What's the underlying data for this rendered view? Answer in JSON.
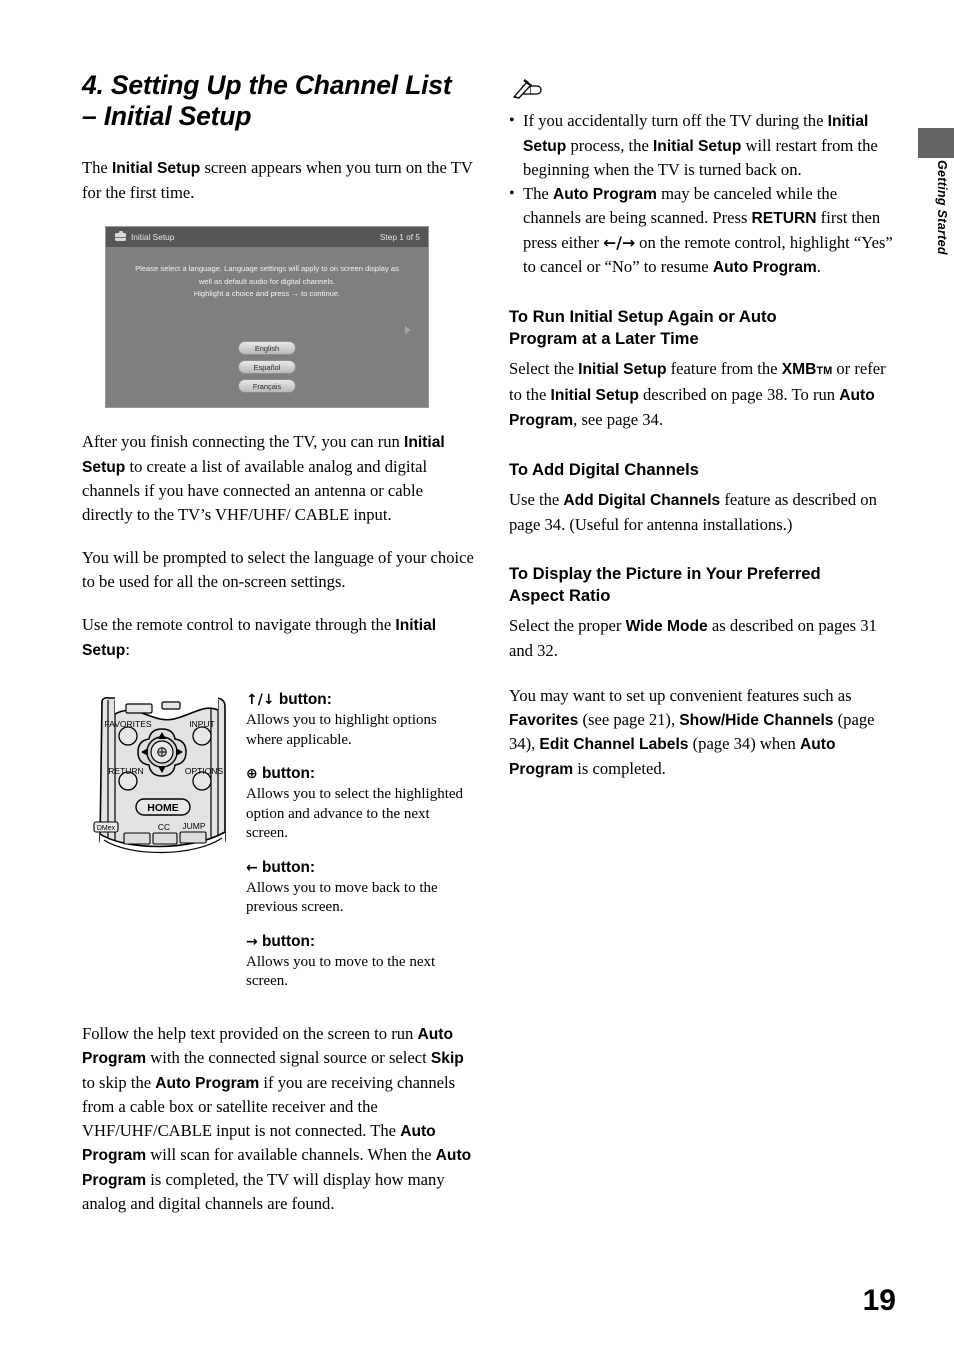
{
  "sidebar": {
    "tab_label": "Getting Started",
    "tab_color": "#646464"
  },
  "page_number": "19",
  "left": {
    "title_line1": "4. Setting Up the Channel List",
    "title_line2": "– Initial Setup",
    "intro": {
      "t1": "The ",
      "b1": "Initial Setup",
      "t2": " screen appears when you turn on the TV for the first time."
    },
    "tv_screen": {
      "header_title": "Initial Setup",
      "header_step": "Step 1 of 5",
      "instruction_line1": "Please select a language. Language settings will apply to on screen display as",
      "instruction_line2": "well as default audio for digital channels.",
      "instruction_line3": "Highlight a choice and press → to continue.",
      "languages": [
        "English",
        "Español",
        "Français"
      ],
      "bg_color": "#7f7f7f",
      "header_color": "#565656"
    },
    "para2": {
      "t1": "After you finish connecting the TV, you can run ",
      "b1": "Initial Setup",
      "t2": " to create a list of available analog and digital channels if you have connected an antenna or cable directly to the TV’s VHF/UHF/ CABLE input."
    },
    "para3": "You will be prompted to select the language of your choice to be used for all the on-screen settings.",
    "para4": {
      "t1": "Use the remote control to navigate through the ",
      "b1": "Initial Setup",
      "t2": ":"
    },
    "remote": {
      "labels": {
        "favorites": "FAVORITES",
        "input": "INPUT",
        "return": "RETURN",
        "options": "OPTIONS",
        "home": "HOME",
        "dmex": "DMex",
        "cc": "CC",
        "jump": "JUMP"
      }
    },
    "buttons": [
      {
        "glyph": "✦/✦",
        "glyph_text": "↑/↓",
        "label": " button",
        "colon": ":",
        "desc": "Allows you to highlight options where applicable."
      },
      {
        "glyph": "⊙",
        "glyph_text": "⊕",
        "label": " button",
        "colon": ":",
        "desc": "Allows you to select the highlighted option and advance to the next screen."
      },
      {
        "glyph": "←",
        "glyph_text": "←",
        "label": " button",
        "colon": ":",
        "desc": "Allows you to move back to the previous screen."
      },
      {
        "glyph": "→",
        "glyph_text": "→",
        "label": " button",
        "colon": ":",
        "desc": "Allows you to move to the next screen."
      }
    ],
    "para5": {
      "t1": "Follow the help text provided on the screen to run ",
      "b1": "Auto Program",
      "t2": " with the connected signal source or select ",
      "b2": "Skip",
      "t3": " to skip the ",
      "b3": "Auto Program",
      "t4": " if you are receiving channels from a cable box or satellite receiver and the VHF/UHF/CABLE input is not connected. The ",
      "b4": "Auto Program",
      "t5": " will scan for available channels. When the ",
      "b5": "Auto Program",
      "t6": " is completed, the TV will display how many analog and digital channels are found."
    }
  },
  "right": {
    "note_icon_name": "note-pencil-icon",
    "notes": [
      {
        "t1": "If you accidentally turn off the TV during the ",
        "b1": "Initial Setup",
        "t2": " process, the ",
        "b2": "Initial Setup",
        "t3": " will restart from the beginning when the TV is turned back on."
      },
      {
        "t1": "The ",
        "b1": "Auto Program",
        "t2": " may be canceled while the channels are being scanned. Press ",
        "b2": "RETURN",
        "t3": " first then press either ",
        "g1": "←/→",
        "t4": " on the remote control, highlight “Yes” to cancel or “No” to resume ",
        "b3": "Auto Program",
        "t5": "."
      }
    ],
    "sections": [
      {
        "heading_l1": "To Run Initial Setup Again or Auto",
        "heading_l2": "Program at a Later Time",
        "body": {
          "t1": "Select the ",
          "b1": "Initial Setup",
          "t2": " feature from the ",
          "b2": "XMB",
          "sup": "TM",
          "t3": " or refer to the ",
          "b3": "Initial Setup",
          "t4": " described on page 38. To run ",
          "b4": "Auto Program",
          "t5": ", see page 34."
        }
      },
      {
        "heading_l1": "To Add Digital Channels",
        "heading_l2": "",
        "body": {
          "t1": "Use the ",
          "b1": "Add Digital Channels",
          "t2": " feature as described on page 34. (Useful for antenna installations.)"
        }
      },
      {
        "heading_l1": "To Display the Picture in Your Preferred",
        "heading_l2": "Aspect Ratio",
        "body": {
          "t1": "Select the proper ",
          "b1": "Wide Mode",
          "t2": " as described on pages 31 and 32."
        }
      }
    ],
    "closing": {
      "t1": "You may want to set up convenient features such as ",
      "b1": "Favorites",
      "t2": " (see page 21), ",
      "b2": "Show/Hide Channels",
      "t3": " (page 34), ",
      "b3": "Edit Channel Labels",
      "t4": " (page 34) when ",
      "b4": "Auto Program",
      "t5": " is completed."
    }
  }
}
